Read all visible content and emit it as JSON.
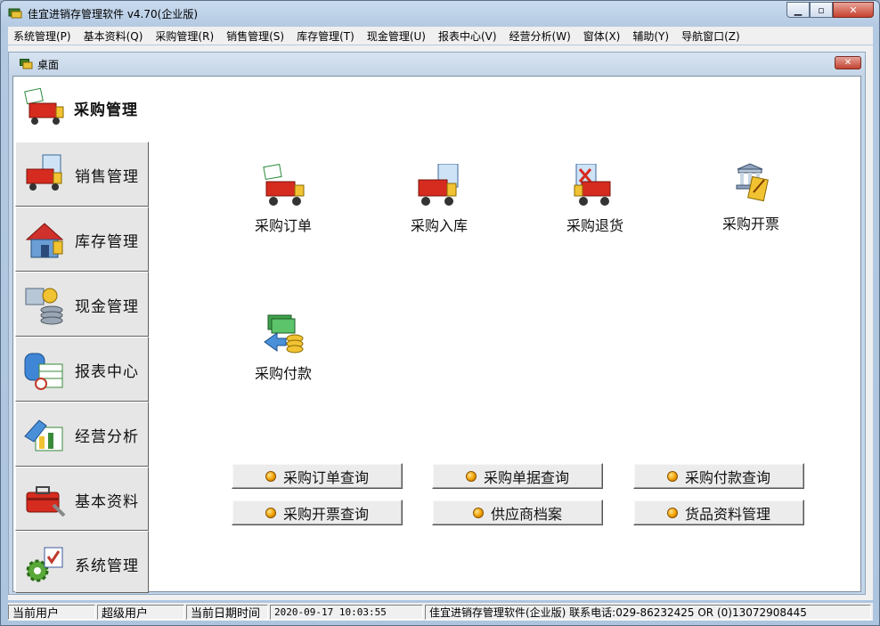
{
  "window": {
    "title": "佳宜进销存管理软件 v4.70(企业版)",
    "min_icon": "minimize-icon",
    "max_icon": "maximize-icon",
    "close_icon": "close-icon"
  },
  "menu": [
    "系统管理(P)",
    "基本资料(Q)",
    "采购管理(R)",
    "销售管理(S)",
    "库存管理(T)",
    "现金管理(U)",
    "报表中心(V)",
    "经营分析(W)",
    "窗体(X)",
    "辅助(Y)",
    "导航窗口(Z)"
  ],
  "desktop": {
    "title": "桌面"
  },
  "sidebar": [
    {
      "label": "采购管理",
      "icon": "purchase-truck-icon",
      "active": true
    },
    {
      "label": "销售管理",
      "icon": "sales-truck-icon"
    },
    {
      "label": "库存管理",
      "icon": "warehouse-house-icon"
    },
    {
      "label": "现金管理",
      "icon": "cash-coins-icon"
    },
    {
      "label": "报表中心",
      "icon": "report-database-icon"
    },
    {
      "label": "经营分析",
      "icon": "analysis-chart-icon"
    },
    {
      "label": "基本资料",
      "icon": "toolbox-icon"
    },
    {
      "label": "系统管理",
      "icon": "settings-gear-icon"
    }
  ],
  "tiles": [
    {
      "label": "采购订单",
      "icon": "purchase-order-icon"
    },
    {
      "label": "采购入库",
      "icon": "purchase-inbound-icon"
    },
    {
      "label": "采购退货",
      "icon": "purchase-return-icon"
    },
    {
      "label": "采购开票",
      "icon": "purchase-invoice-icon"
    },
    {
      "label": "采购付款",
      "icon": "purchase-payment-icon"
    }
  ],
  "query_buttons": [
    "采购订单查询",
    "采购单据查询",
    "采购付款查询",
    "采购开票查询",
    "供应商档案",
    "货品资料管理"
  ],
  "status": {
    "user_label": "当前用户",
    "user_value": "超级用户",
    "datetime_label": "当前日期时间",
    "datetime_value": "2020-09-17 10:03:55",
    "info": "佳宜进销存管理软件(企业版) 联系电话:029-86232425 OR (0)13072908445"
  }
}
